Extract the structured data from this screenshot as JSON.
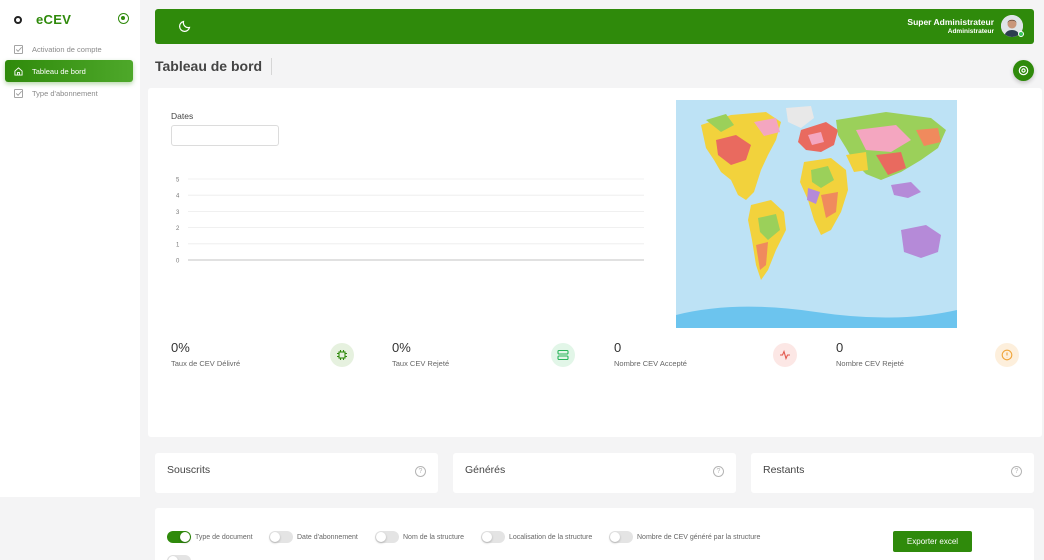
{
  "brand": {
    "name": "eCEV"
  },
  "sidebar": {
    "items": [
      {
        "label": "Activation de compte",
        "icon": "check-square-icon",
        "active": false
      },
      {
        "label": "Tableau de bord",
        "icon": "home-icon",
        "active": true
      },
      {
        "label": "Type d'abonnement",
        "icon": "check-square-icon",
        "active": false
      }
    ]
  },
  "topbar": {
    "user_name": "Super Administrateur",
    "user_role": "Administrateur"
  },
  "page": {
    "title": "Tableau de bord"
  },
  "filters": {
    "dates_label": "Dates",
    "dates_value": ""
  },
  "chart_data": {
    "type": "line",
    "x": [],
    "series": [],
    "yticks": [
      5,
      4,
      3,
      2,
      1,
      0
    ],
    "ylim": [
      0,
      5
    ],
    "grid": true
  },
  "kpis": [
    {
      "value": "0%",
      "label": "Taux de CEV Délivré",
      "icon": "chip-icon",
      "color": "#2f8a0b",
      "bg": "#e6f1df"
    },
    {
      "value": "0%",
      "label": "Taux CEV Rejeté",
      "icon": "server-icon",
      "color": "#29b45a",
      "bg": "#e2f6e8"
    },
    {
      "value": "0",
      "label": "Nombre CEV Accepté",
      "icon": "activity-icon",
      "color": "#e2574c",
      "bg": "#fce7e5"
    },
    {
      "value": "0",
      "label": "Nombre CEV Rejeté",
      "icon": "alert-circle-icon",
      "color": "#f0a53a",
      "bg": "#fdefdc"
    }
  ],
  "cards": [
    {
      "title": "Souscrits"
    },
    {
      "title": "Générés"
    },
    {
      "title": "Restants"
    }
  ],
  "columns": [
    {
      "label": "Type de document",
      "on": true
    },
    {
      "label": "Date d'abonnement",
      "on": false
    },
    {
      "label": "Nom de la structure",
      "on": false
    },
    {
      "label": "Localisation de la structure",
      "on": false
    },
    {
      "label": "Nombre de CEV généré par la structure",
      "on": false
    }
  ],
  "export_label": "Exporter excel",
  "colors": {
    "primary": "#2f8a0b",
    "background": "#f4f4f5"
  }
}
